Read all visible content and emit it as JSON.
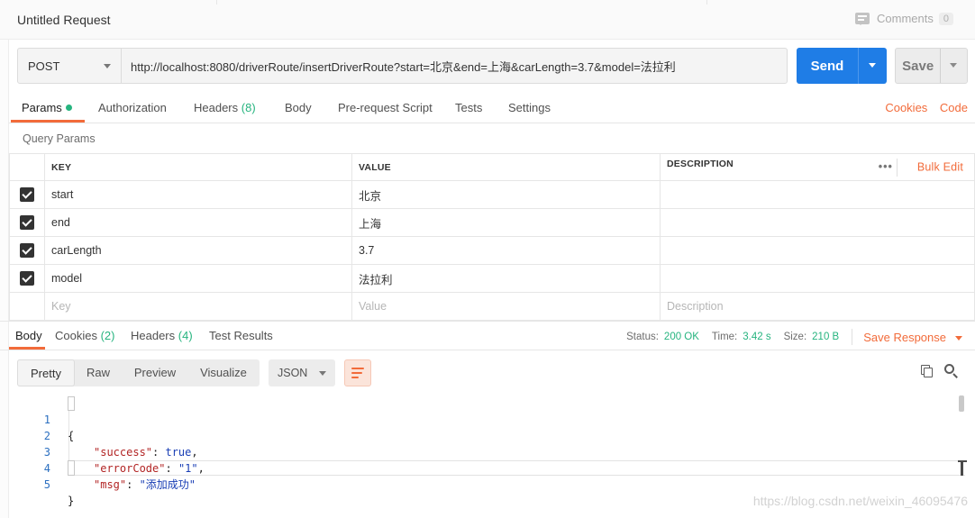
{
  "app": {
    "title": "Untitled Request",
    "comments_label": "Comments",
    "comments_count": "0"
  },
  "request": {
    "method": "POST",
    "url": "http://localhost:8080/driverRoute/insertDriverRoute?start=北京&end=上海&carLength=3.7&model=法拉利",
    "send_label": "Send",
    "save_label": "Save"
  },
  "request_tabs": {
    "params": "Params",
    "authorization": "Authorization",
    "headers": "Headers",
    "headers_count": "(8)",
    "body": "Body",
    "pre_request": "Pre-request Script",
    "tests": "Tests",
    "settings": "Settings",
    "cookies_link": "Cookies",
    "code_link": "Code"
  },
  "query_params": {
    "title": "Query Params",
    "columns": [
      "KEY",
      "VALUE",
      "DESCRIPTION"
    ],
    "bulk_edit": "Bulk Edit",
    "more": "•••",
    "rows": [
      {
        "key": "start",
        "value": "北京",
        "description": ""
      },
      {
        "key": "end",
        "value": "上海",
        "description": ""
      },
      {
        "key": "carLength",
        "value": "3.7",
        "description": ""
      },
      {
        "key": "model",
        "value": "法拉利",
        "description": ""
      }
    ],
    "placeholder": {
      "key": "Key",
      "value": "Value",
      "description": "Description"
    }
  },
  "response_tabs": {
    "body": "Body",
    "cookies": "Cookies",
    "cookies_count": "(2)",
    "headers": "Headers",
    "headers_count": "(4)",
    "test_results": "Test Results"
  },
  "response_meta": {
    "status_label": "Status:",
    "status_value": "200 OK",
    "time_label": "Time:",
    "time_value": "3.42 s",
    "size_label": "Size:",
    "size_value": "210 B",
    "save_response": "Save Response"
  },
  "viewer": {
    "modes": [
      "Pretty",
      "Raw",
      "Preview",
      "Visualize"
    ],
    "format": "JSON",
    "lines": [
      {
        "n": "1",
        "text": "{"
      },
      {
        "n": "2",
        "key": "\"success\"",
        "value": "true",
        "tail": ","
      },
      {
        "n": "3",
        "key": "\"errorCode\"",
        "value": "\"1\"",
        "tail": ","
      },
      {
        "n": "4",
        "key": "\"msg\"",
        "value": "\"添加成功\"",
        "tail": ""
      },
      {
        "n": "5",
        "text": "}"
      }
    ]
  },
  "watermark": "https://blog.csdn.net/weixin_46095476",
  "colors": {
    "accent": "#f26b3a",
    "send": "#1f7de6",
    "ok": "#26b47f"
  }
}
